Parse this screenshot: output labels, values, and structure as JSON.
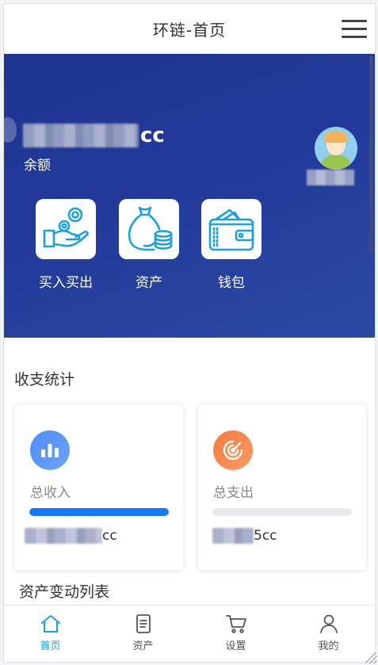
{
  "header": {
    "title": "环链-首页",
    "menu_icon": "hamburger-menu-icon"
  },
  "banner": {
    "balance_suffix": "cc",
    "balance_label": "余额",
    "actions": [
      {
        "label": "买入买出",
        "icon": "hand-coins-icon"
      },
      {
        "label": "资产",
        "icon": "money-bag-icon"
      },
      {
        "label": "钱包",
        "icon": "wallet-icon"
      }
    ]
  },
  "stats": {
    "title": "收支统计",
    "income": {
      "label": "总收入",
      "amount_suffix": "cc",
      "progress": 1.0,
      "icon": "bar-chart-icon"
    },
    "expense": {
      "label": "总支出",
      "amount_suffix": "5cc",
      "progress": 0.0,
      "icon": "target-icon"
    }
  },
  "list_title": "资产变动列表",
  "tabbar": [
    {
      "label": "首页",
      "icon": "home-icon",
      "active": true
    },
    {
      "label": "资产",
      "icon": "document-icon",
      "active": false
    },
    {
      "label": "设置",
      "icon": "cart-icon",
      "active": false
    },
    {
      "label": "我的",
      "icon": "user-icon",
      "active": false
    }
  ],
  "colors": {
    "banner": "#22399a",
    "accent": "#1677ff",
    "active_tab": "#1aa0e0"
  }
}
